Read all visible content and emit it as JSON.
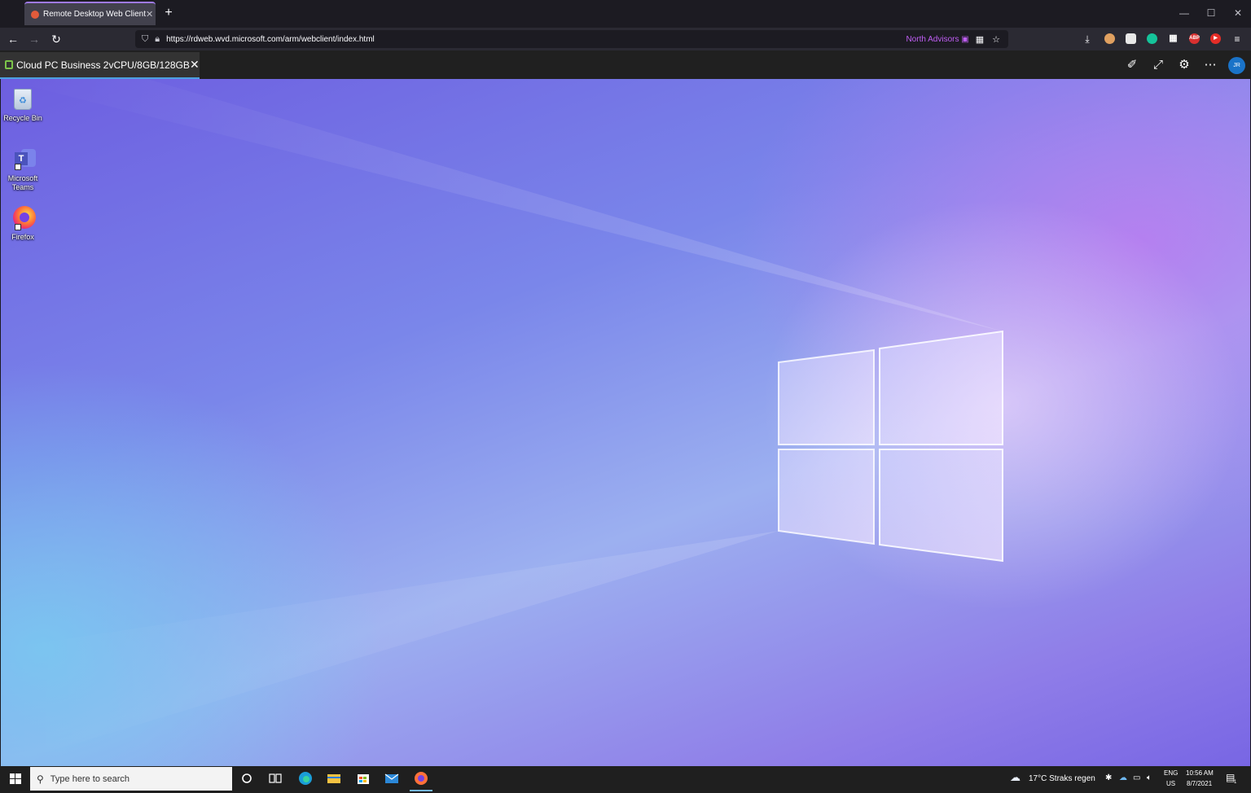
{
  "browser": {
    "tab_title": "Remote Desktop Web Client",
    "url": "https://rdweb.wvd.microsoft.com/arm/webclient/index.html",
    "container_badge": "North Advisors",
    "extensions": [
      "ABP"
    ]
  },
  "rd_client": {
    "session_tab": "Cloud PC Business 2vCPU/8GB/128GB",
    "avatar_initials": "JR"
  },
  "desktop": {
    "icons": [
      {
        "label": "Recycle Bin"
      },
      {
        "label": "Microsoft Teams"
      },
      {
        "label": "Firefox"
      }
    ]
  },
  "taskbar": {
    "search_placeholder": "Type here to search",
    "weather": "17°C  Straks regen",
    "lang_top": "ENG",
    "lang_bottom": "US",
    "time": "10:56 AM",
    "date": "8/7/2021",
    "notification_count": "1"
  }
}
